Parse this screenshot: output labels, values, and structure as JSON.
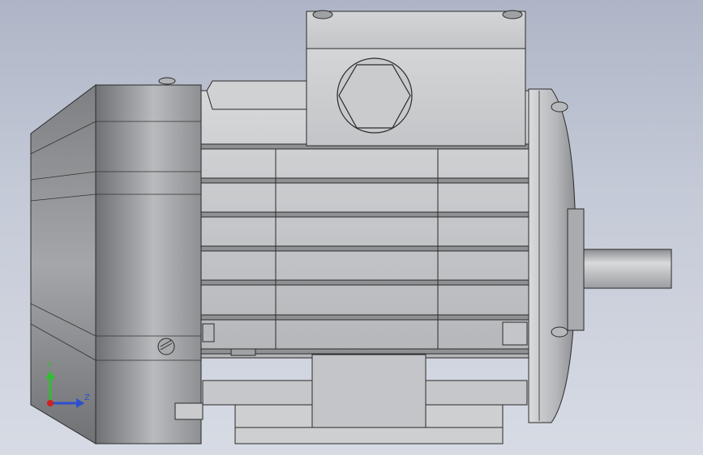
{
  "viewport": {
    "background_top": "#aeb5c6",
    "background_bottom": "#d7dbe4"
  },
  "model": {
    "description_icon": "electric-motor-model",
    "body_color": "#c9cbcd",
    "edge_color": "#2a2a2a"
  },
  "triad": {
    "y_label": "Y",
    "z_label": "Z",
    "y_color": "#2fbf2f",
    "z_color": "#2f4fd0",
    "x_color": "#d02020"
  }
}
